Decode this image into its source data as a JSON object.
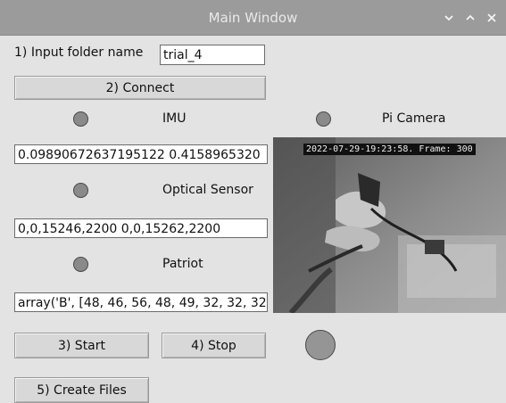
{
  "window": {
    "title": "Main Window",
    "controls": [
      "minimize-icon",
      "maximize-icon",
      "close-icon"
    ]
  },
  "folder": {
    "label": "1) Input folder name",
    "value": "trial_4"
  },
  "buttons": {
    "connect": "2) Connect",
    "start": "3) Start",
    "stop": "4) Stop",
    "create_files": "5) Create Files"
  },
  "sensors": {
    "imu": {
      "label": "IMU",
      "value": "0.09890672637195122 0.4158965320"
    },
    "pi_camera": {
      "label": "Pi Camera"
    },
    "optical": {
      "label": "Optical Sensor",
      "value": "0,0,15246,2200 0,0,15262,2200"
    },
    "patriot": {
      "label": "Patriot",
      "value": "array('B', [48, 46, 56, 48, 49, 32, 32, 32"
    }
  },
  "camera_feed": {
    "overlay": "2022-07-29-19:23:58. Frame: 300"
  },
  "colors": {
    "titlebar": "#9b9b9b",
    "background": "#e3e3e3",
    "indicator": "#8a8a8a"
  }
}
